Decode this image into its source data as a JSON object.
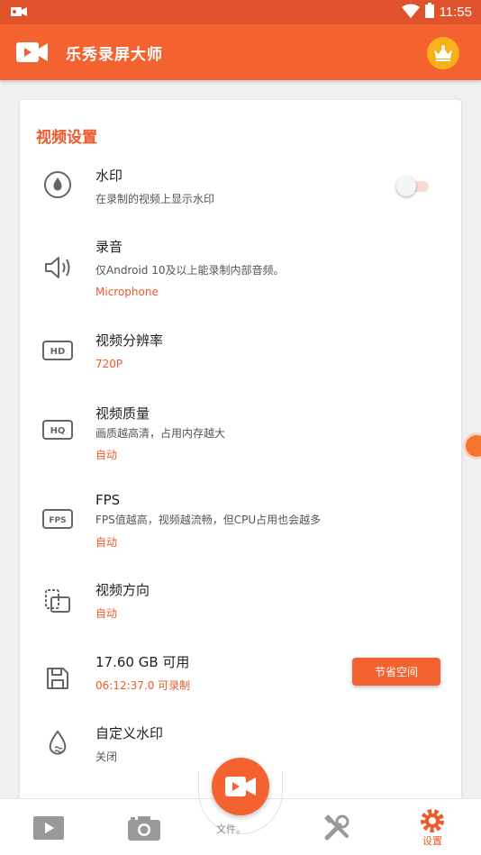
{
  "status_bar": {
    "time": "11:55"
  },
  "app": {
    "title": "乐秀录屏大师"
  },
  "section": {
    "title": "视频设置"
  },
  "settings": {
    "watermark": {
      "title": "水印",
      "desc": "在录制的视频上显示水印",
      "enabled": false
    },
    "audio": {
      "title": "录音",
      "desc": "仅Android 10及以上能录制内部音频。",
      "value": "Microphone"
    },
    "resolution": {
      "title": "视频分辨率",
      "value": "720P"
    },
    "quality": {
      "title": "视频质量",
      "desc": "画质越高清，占用内存越大",
      "value": "自动"
    },
    "fps": {
      "title": "FPS",
      "desc": "FPS值越高，视频越流畅，但CPU占用也会越多",
      "value": "自动"
    },
    "orientation": {
      "title": "视频方向",
      "value": "自动"
    },
    "storage": {
      "title": "17.60 GB 可用",
      "value": "06:12:37.0 可录制",
      "button": "节省空间"
    },
    "custom_watermark": {
      "title": "自定义水印",
      "desc": "关闭"
    }
  },
  "bottom_nav": {
    "record_label": "文件。",
    "settings_label": "设置"
  },
  "colors": {
    "accent": "#f4632f",
    "status_bar": "#e0522b",
    "text_accent": "#ef5a2a"
  }
}
